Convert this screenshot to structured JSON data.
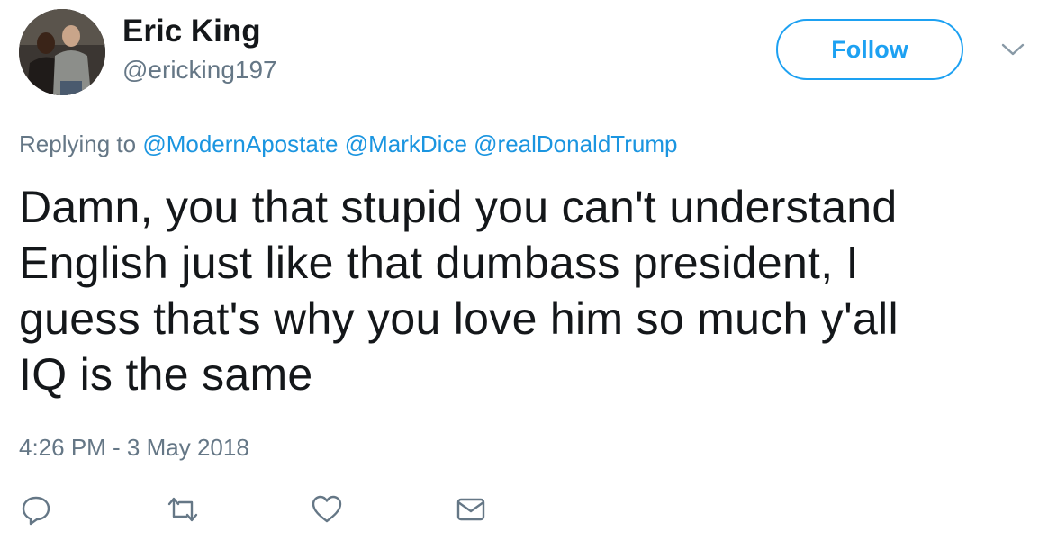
{
  "user": {
    "name": "Eric King",
    "handle": "@ericking197"
  },
  "follow_button": {
    "label": "Follow"
  },
  "reply_context": {
    "prefix": "Replying to",
    "mentions": [
      "@ModernApostate",
      "@MarkDice",
      "@realDonaldTrump"
    ]
  },
  "tweet": {
    "lines": [
      "Damn, you that stupid you can't understand",
      "English just like that dumbass president, I",
      "guess that's why you love him so much y'all",
      "IQ is the same"
    ],
    "timestamp": "4:26 PM - 3 May 2018"
  },
  "actions": {
    "icons": [
      "reply-icon",
      "retweet-icon",
      "like-icon",
      "direct-message-icon"
    ]
  },
  "colors": {
    "accent": "#1da1f2",
    "link": "#1b95e0",
    "text": "#14171a",
    "secondary_text": "#657786"
  }
}
